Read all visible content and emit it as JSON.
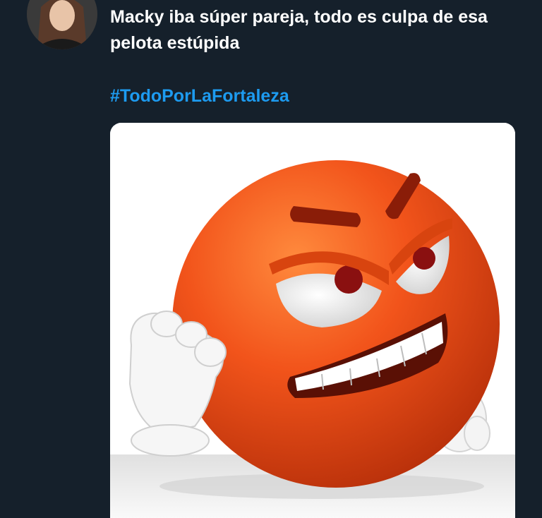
{
  "tweet": {
    "text": "Macky iba súper pareja, todo es culpa de esa pelota estúpida",
    "hashtag": "#TodoPorLaFortaleza"
  },
  "colors": {
    "background": "#15202b",
    "text": "#ffffff",
    "hashtag": "#1d9bf0",
    "emoji_orange": "#f2541b"
  },
  "media": {
    "icon": "angry-orange-emoji-fist"
  }
}
